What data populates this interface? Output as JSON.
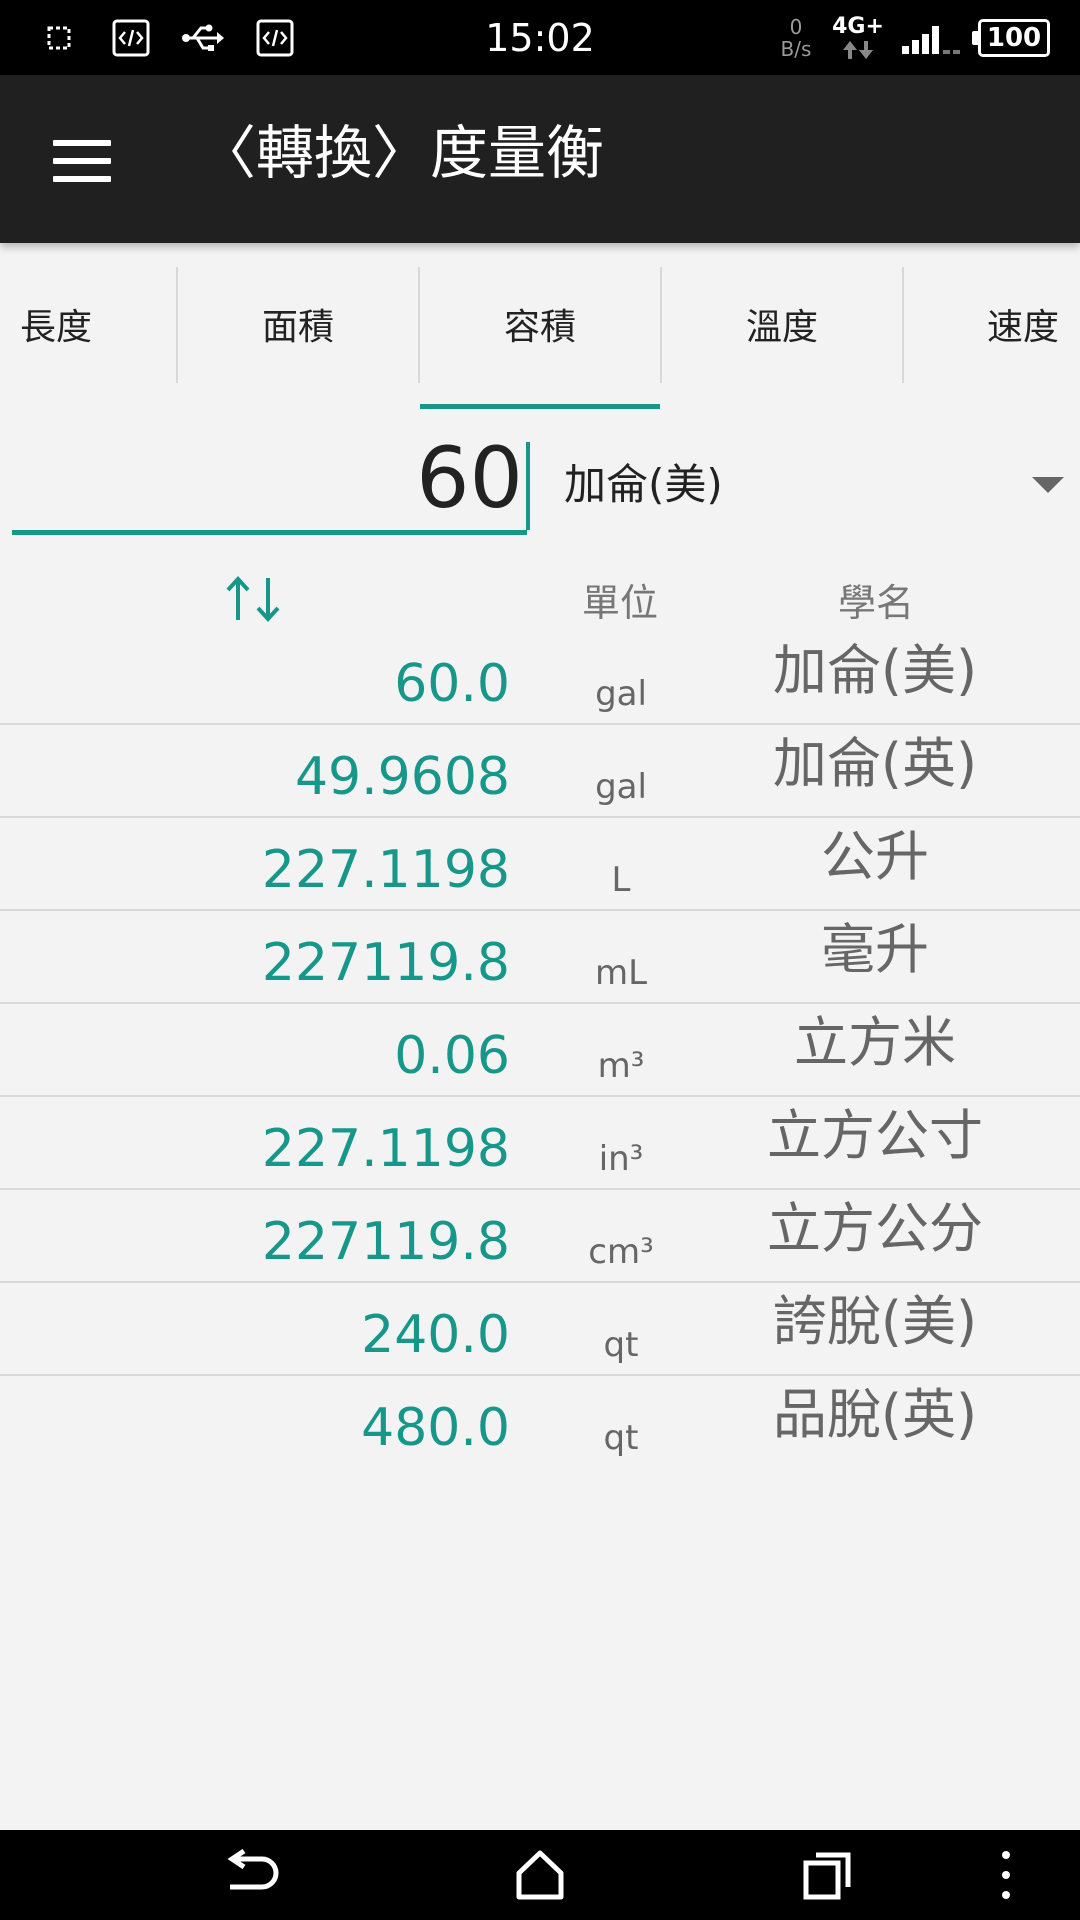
{
  "status_bar": {
    "time": "15:02",
    "net_speed_value": "0",
    "net_speed_unit": "B/s",
    "network_type": "4G+",
    "battery": "100"
  },
  "app_bar": {
    "title": "〈轉換〉度量衡"
  },
  "tabs": [
    {
      "label": "長度"
    },
    {
      "label": "面積"
    },
    {
      "label": "容積"
    },
    {
      "label": "溫度"
    },
    {
      "label": "速度"
    }
  ],
  "selected_tab": "容積",
  "input": {
    "value": "60",
    "selected_unit": "加侖(美)"
  },
  "header": {
    "unit": "單位",
    "name": "學名"
  },
  "rows": [
    {
      "value": "60.0",
      "unit": "gal",
      "name": "加侖(美)"
    },
    {
      "value": "49.9608",
      "unit": "gal",
      "name": "加侖(英)"
    },
    {
      "value": "227.1198",
      "unit": "L",
      "name": "公升"
    },
    {
      "value": "227119.8",
      "unit": "mL",
      "name": "毫升"
    },
    {
      "value": "0.06",
      "unit": "m³",
      "name": "立方米"
    },
    {
      "value": "227.1198",
      "unit": "in³",
      "name": "立方公寸"
    },
    {
      "value": "227119.8",
      "unit": "cm³",
      "name": "立方公分"
    },
    {
      "value": "240.0",
      "unit": "qt",
      "name": "誇脫(美)"
    },
    {
      "value": "480.0",
      "unit": "qt",
      "name": "品脫(英)"
    }
  ],
  "colors": {
    "accent": "#16978a",
    "app_bar": "#202020",
    "background": "#f3f3f3"
  }
}
